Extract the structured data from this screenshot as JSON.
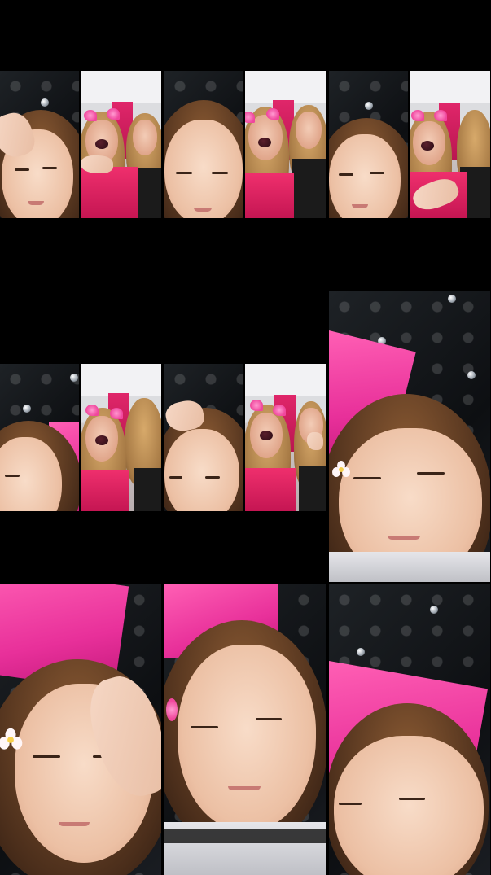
{
  "grid": {
    "background": "#000000",
    "tiles": [
      {
        "id": "tile-1",
        "layout": "split",
        "left_subject": "woman-hand-on-forehead",
        "right_subject": "two-women-pink-filter"
      },
      {
        "id": "tile-2",
        "layout": "split",
        "left_subject": "woman-closeup-eyes-closed",
        "right_subject": "two-women-pink-filter"
      },
      {
        "id": "tile-3",
        "layout": "split",
        "left_subject": "woman-closeup-eyes-closed",
        "right_subject": "two-women-pink-filter-hand-wave"
      },
      {
        "id": "tile-4",
        "layout": "split",
        "left_subject": "woman-closeup-eyes-closed",
        "right_subject": "two-women-pink-filter"
      },
      {
        "id": "tile-5",
        "layout": "split",
        "left_subject": "woman-closeup-hand-on-head",
        "right_subject": "two-women-pink-filter"
      },
      {
        "id": "tile-6",
        "layout": "full",
        "subject": "woman-eyes-closed-headboard"
      },
      {
        "id": "tile-7",
        "layout": "full",
        "subject": "woman-hand-on-forehead-flower"
      },
      {
        "id": "tile-8",
        "layout": "full",
        "subject": "woman-eyes-closed-sweater"
      },
      {
        "id": "tile-9",
        "layout": "full",
        "subject": "woman-headboard-top"
      }
    ]
  },
  "colors": {
    "filter_pink": "#f0479d",
    "dress_red": "#e0266a",
    "headboard_black": "#111316"
  }
}
